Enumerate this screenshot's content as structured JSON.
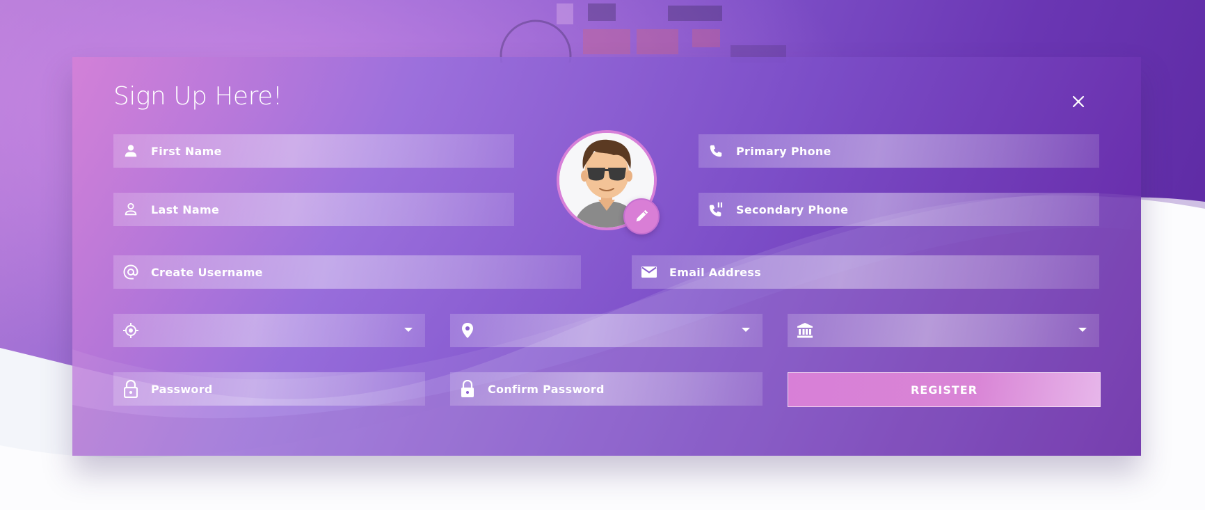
{
  "form": {
    "title": "Sign Up Here!",
    "first_name_placeholder": "First Name",
    "last_name_placeholder": "Last Name",
    "primary_phone_placeholder": "Primary Phone",
    "secondary_phone_placeholder": "Secondary Phone",
    "username_placeholder": "Create Username",
    "email_placeholder": "Email Address",
    "password_placeholder": "Password",
    "confirm_password_placeholder": "Confirm Password",
    "register_label": "REGISTER",
    "select_one_value": "",
    "select_two_value": "",
    "select_three_value": ""
  },
  "icons": {
    "close": "close-icon",
    "first_name": "person-icon",
    "last_name": "person-outline-icon",
    "primary_phone": "phone-icon",
    "secondary_phone": "phone-paused-icon",
    "username": "at-icon",
    "email": "mail-icon",
    "select_one": "location-target-icon",
    "select_two": "map-pin-icon",
    "select_three": "bank-icon",
    "password": "lock-open-icon",
    "confirm_password": "lock-icon",
    "edit_avatar": "pencil-icon"
  },
  "colors": {
    "accent": "#d97ed6",
    "card_start": "#d680d6",
    "card_end": "#6426a5",
    "text": "#ffffff"
  }
}
